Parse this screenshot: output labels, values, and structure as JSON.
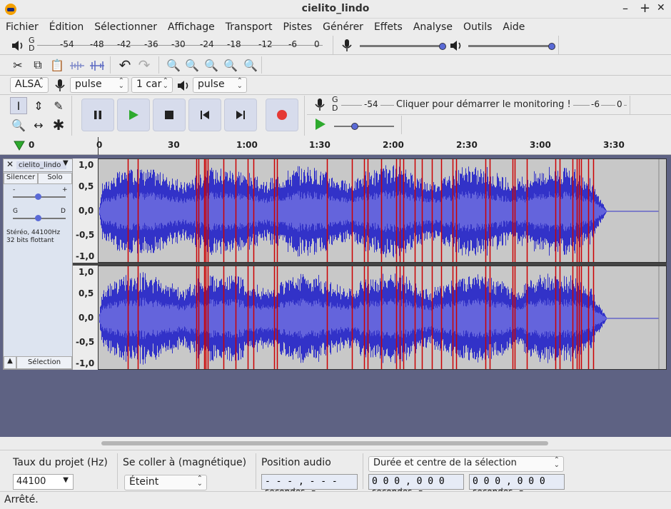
{
  "window": {
    "title": "cielito_lindo",
    "minimize": "–",
    "maximize": "+",
    "close": "✕"
  },
  "menu": [
    "Fichier",
    "Édition",
    "Sélectionner",
    "Affichage",
    "Transport",
    "Pistes",
    "Générer",
    "Effets",
    "Analyse",
    "Outils",
    "Aide"
  ],
  "playback_meter": {
    "label_lr": "G\nD",
    "ticks": [
      "-54",
      "-48",
      "-42",
      "-36",
      "-30",
      "-24",
      "-18",
      "-12",
      "-6",
      "0"
    ]
  },
  "record_meter": {
    "label_lr": "G\nD",
    "ticks_left": "-54",
    "message": "Cliquer pour démarrer le monitoring !",
    "ticks_right": [
      "-6",
      "0"
    ]
  },
  "device": {
    "host": "ALSA",
    "input": "pulse",
    "channels": "1 car",
    "output": "pulse"
  },
  "ruler": {
    "ticks": [
      "0",
      "30",
      "1:00",
      "1:30",
      "2:00",
      "2:30",
      "3:00",
      "3:30"
    ],
    "left_marker": "0"
  },
  "track": {
    "name": "cielito_lindo",
    "mute": "Silencer",
    "solo": "Solo",
    "gain_minus": "-",
    "gain_plus": "+",
    "pan_left": "G",
    "pan_right": "D",
    "info1": "Stéréo, 44100Hz",
    "info2": "32 bits flottant",
    "select": "Sélection",
    "scale": [
      "1,0",
      "0,5",
      "0,0",
      "-0,5",
      "-1,0"
    ]
  },
  "bottom": {
    "rate_label": "Taux du projet (Hz)",
    "rate_value": "44100",
    "snap_label": "Se coller à (magnétique)",
    "snap_value": "Éteint",
    "pos_label": "Position audio",
    "pos_value": "- - - , - - -",
    "pos_unit": "secondes",
    "sel_mode": "Durée et centre de la sélection",
    "sel_start": "0 0 0 , 0 0 0",
    "sel_start_unit": "secondes",
    "sel_end": "0 0 0 , 0 0 0",
    "sel_end_unit": "secondes"
  },
  "status": "Arrêté.",
  "colors": {
    "wave": "#3232c8",
    "wave_rms": "#6464dc",
    "clip": "#cc0000",
    "wave_bg": "#c8c8c8",
    "record": "#e53935",
    "play": "#2eaa2e"
  }
}
